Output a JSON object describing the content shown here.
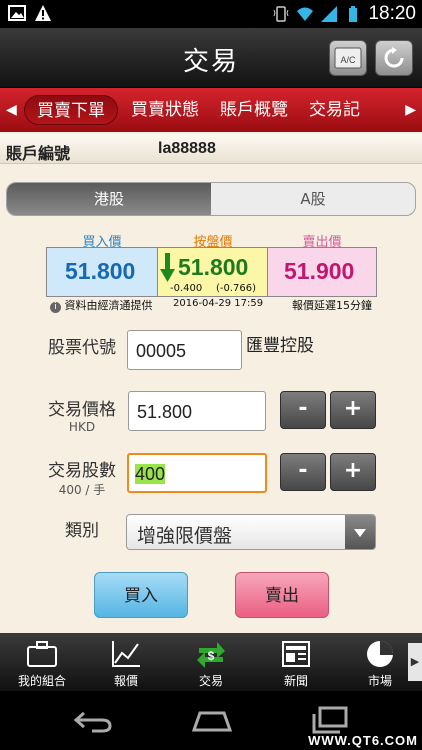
{
  "status_bar": {
    "time": "18:20"
  },
  "header": {
    "title": "交易"
  },
  "tabs": [
    {
      "label": "買賣下單",
      "active": true
    },
    {
      "label": "買賣狀態",
      "active": false
    },
    {
      "label": "賬戶概覽",
      "active": false
    },
    {
      "label": "交易記",
      "active": false
    }
  ],
  "account": {
    "label": "賬戶編號",
    "value": "la88888"
  },
  "market_toggle": {
    "options": [
      "港股",
      "A股"
    ],
    "selected": "港股"
  },
  "quote": {
    "bid_label": "買入價",
    "bid": "51.800",
    "nominal_label": "按盤價",
    "nominal": "51.800",
    "change": "-0.400",
    "change_pct": "(-0.766)",
    "ask_label": "賣出價",
    "ask": "51.900",
    "source": "資料由經濟通提供",
    "timestamp": "2016-04-29 17:59",
    "delay_note": "報價延遲15分鐘"
  },
  "form": {
    "stock_code_label": "股票代號",
    "stock_code": "00005",
    "stock_name": "匯豐控股",
    "price_label": "交易價格",
    "price_currency": "HKD",
    "price": "51.800",
    "qty_label": "交易股數",
    "lot_info": "400 / 手",
    "qty": "400",
    "type_label": "類別",
    "type_value": "增強限價盤",
    "minus": "-",
    "plus": "+"
  },
  "actions": {
    "buy": "買入",
    "sell": "賣出"
  },
  "bottom_nav": [
    {
      "label": "我的組合",
      "icon": "briefcase-icon"
    },
    {
      "label": "報價",
      "icon": "line-chart-icon"
    },
    {
      "label": "交易",
      "icon": "exchange-icon",
      "active": true
    },
    {
      "label": "新聞",
      "icon": "newspaper-icon"
    },
    {
      "label": "市場",
      "icon": "pie-chart-icon"
    }
  ],
  "watermark": "WWW.QT6.COM",
  "colors": {
    "red_tab": "#c61b22",
    "bid_box": "#cfe9fb",
    "nominal_box": "#fbf7a6",
    "ask_box": "#f9d6ea",
    "bid_text": "#1768b3",
    "ask_text": "#c2176f",
    "nominal_label": "#e07a00",
    "buy_button": "#72c5ec",
    "sell_button": "#ef6f8f",
    "trade_icon": "#2fa82f"
  }
}
